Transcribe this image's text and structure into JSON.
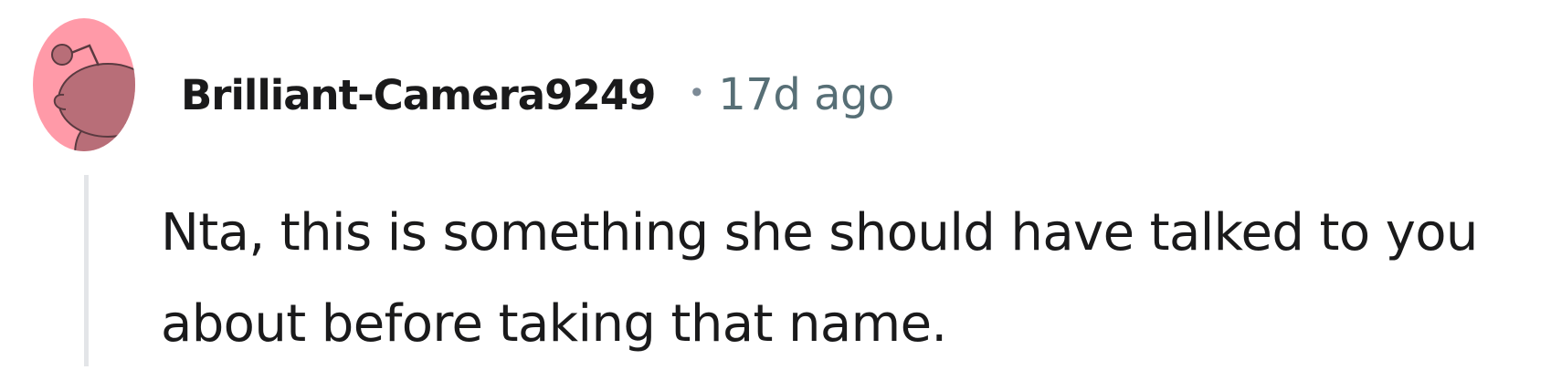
{
  "comment": {
    "author": "Brilliant-Camera9249",
    "separator": "•",
    "timestamp": "17d ago",
    "body": "Nta, this is something she should have talked to you about before taking that name."
  },
  "avatar": {
    "icon": "snoo-avatar-icon",
    "background_color": "#ff9aa8",
    "figure_color": "#b86e78"
  },
  "colors": {
    "text": "#1a1a1b",
    "meta": "#576f76",
    "thread_line": "#e3e5e8"
  }
}
